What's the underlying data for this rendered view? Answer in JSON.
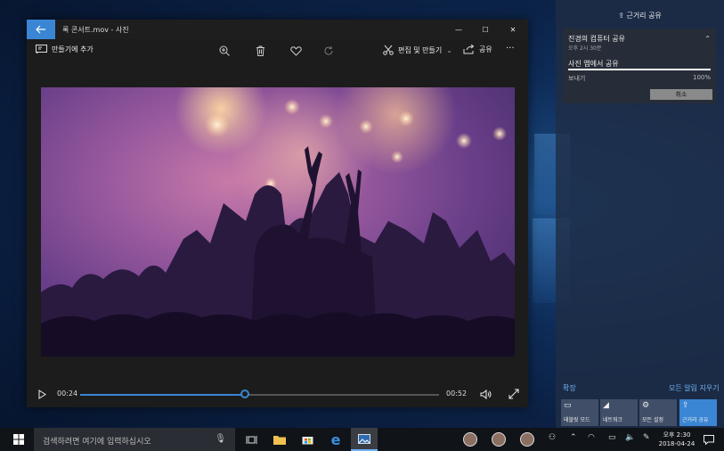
{
  "window": {
    "title": "록 콘서트.mov - 사진",
    "controls": {
      "minimize": "—",
      "maximize": "☐",
      "close": "✕"
    }
  },
  "toolbar": {
    "add_to_creation": "만들기에 추가",
    "edit_create": "편집 및 만들기",
    "share": "공유",
    "more": "···"
  },
  "video": {
    "current_time": "00:24",
    "duration": "00:52",
    "progress": 0.46
  },
  "action_center": {
    "header": "근거리 공유",
    "card": {
      "title": "진경의 컴퓨터 공유",
      "subtitle": "오후 2시 30분",
      "status": "사진 앱에서 공유",
      "send_label": "보내기",
      "percent": "100%",
      "progress": 1.0,
      "cancel": "취소"
    },
    "expand": "확장",
    "clear_all": "모든 알림 지우기",
    "tiles": [
      {
        "label": "태블릿 모드",
        "icon": "tablet-icon"
      },
      {
        "label": "네트워크",
        "icon": "network-icon"
      },
      {
        "label": "모든 설정",
        "icon": "settings-icon"
      },
      {
        "label": "근거리 공유",
        "icon": "nearby-share-icon"
      }
    ]
  },
  "taskbar": {
    "search_placeholder": "검색하려면 여기에 입력하십시오",
    "time": "오후 2:30",
    "date": "2018-04-24"
  },
  "colors": {
    "accent": "#3a86d4",
    "window_bg": "#1c1c1c",
    "taskbar_bg": "#101317"
  }
}
